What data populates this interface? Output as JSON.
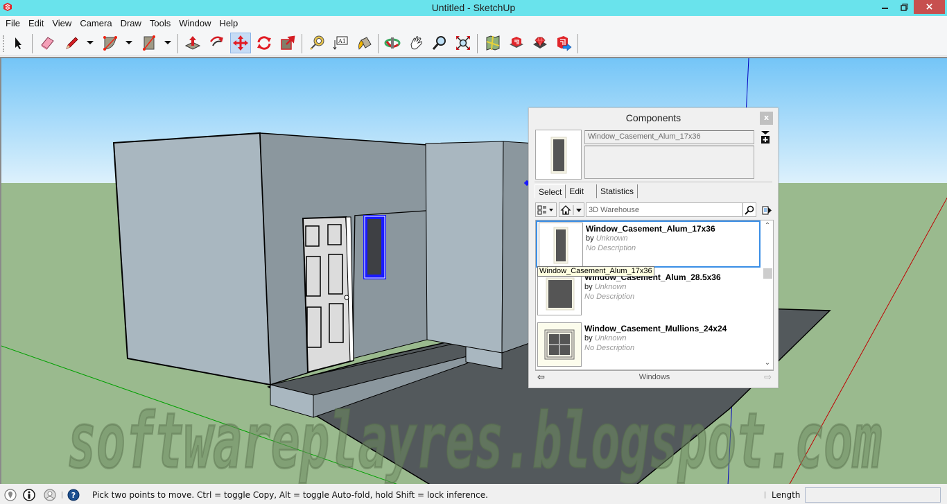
{
  "window": {
    "title": "Untitled - SketchUp",
    "minimize": "minimize",
    "maximize": "restore",
    "close": "×"
  },
  "menu": [
    "File",
    "Edit",
    "View",
    "Camera",
    "Draw",
    "Tools",
    "Window",
    "Help"
  ],
  "toolbar": {
    "tools": [
      {
        "name": "select-tool",
        "icon": "arrow-cursor-icon"
      },
      {
        "name": "eraser-tool",
        "icon": "eraser-icon"
      },
      {
        "name": "line-tool",
        "icon": "pencil-icon"
      },
      {
        "name": "arc-tool",
        "icon": "arc-icon"
      },
      {
        "name": "rectangle-tool",
        "icon": "rectangle-icon"
      },
      {
        "name": "push-pull-tool",
        "icon": "push-pull-icon"
      },
      {
        "name": "offset-tool",
        "icon": "offset-icon"
      },
      {
        "name": "move-tool",
        "icon": "move-icon",
        "active": true
      },
      {
        "name": "rotate-tool",
        "icon": "rotate-icon"
      },
      {
        "name": "scale-tool",
        "icon": "scale-icon"
      },
      {
        "name": "tape-measure-tool",
        "icon": "tape-measure-icon"
      },
      {
        "name": "text-tool",
        "icon": "text-icon"
      },
      {
        "name": "paint-bucket-tool",
        "icon": "paint-bucket-icon"
      },
      {
        "name": "orbit-tool",
        "icon": "orbit-icon"
      },
      {
        "name": "pan-tool",
        "icon": "hand-icon"
      },
      {
        "name": "zoom-tool",
        "icon": "magnifier-icon"
      },
      {
        "name": "zoom-extents-tool",
        "icon": "zoom-extents-icon"
      },
      {
        "name": "add-location-tool",
        "icon": "map-icon"
      },
      {
        "name": "3d-warehouse-tool",
        "icon": "warehouse-icon"
      },
      {
        "name": "extension-warehouse-tool",
        "icon": "ruby-icon"
      },
      {
        "name": "share-model-tool",
        "icon": "share-model-icon"
      }
    ],
    "text_tool_glyph": "A1"
  },
  "components_panel": {
    "title": "Components",
    "close_label": "x",
    "component_name": "Window_Casement_Alum_17x36",
    "component_description": "",
    "tabs": [
      {
        "label": "Select",
        "active": true
      },
      {
        "label": "Edit",
        "active": false
      },
      {
        "label": "Statistics",
        "active": false
      }
    ],
    "search": {
      "value": "3D Warehouse",
      "placeholder": "3D Warehouse"
    },
    "items": [
      {
        "name": "Window_Casement_Alum_17x36",
        "by_prefix": "by",
        "author": "Unknown",
        "description": "No Description",
        "selected": true
      },
      {
        "name": "Window_Casement_Alum_28.5x36",
        "by_prefix": "by",
        "author": "Unknown",
        "description": "No Description",
        "selected": false
      },
      {
        "name": "Window_Casement_Mullions_24x24",
        "by_prefix": "by",
        "author": "Unknown",
        "description": "No Description",
        "selected": false
      }
    ],
    "tooltip": "Window_Casement_Alum_17x36",
    "collection": "Windows"
  },
  "status_bar": {
    "message": "Pick two points to move.  Ctrl = toggle Copy, Alt = toggle Auto-fold, hold Shift = lock inference.",
    "measurement_label": "Length",
    "measurement_value": ""
  },
  "watermark": "softwareplayres.blogspot.com",
  "colors": {
    "titlebar": "#69e3ec",
    "close_button": "#c7504f",
    "sky_top": "#76c6f7",
    "sky_bottom": "#dcf0fc",
    "ground": "#9aba8e",
    "wall_light": "#a9b7c0",
    "wall_dark": "#8b979e",
    "floor": "#53595c",
    "selection": "#1a1aff",
    "axis_green": "#00a000",
    "axis_red": "#c00000",
    "axis_blue": "#0000c0"
  }
}
